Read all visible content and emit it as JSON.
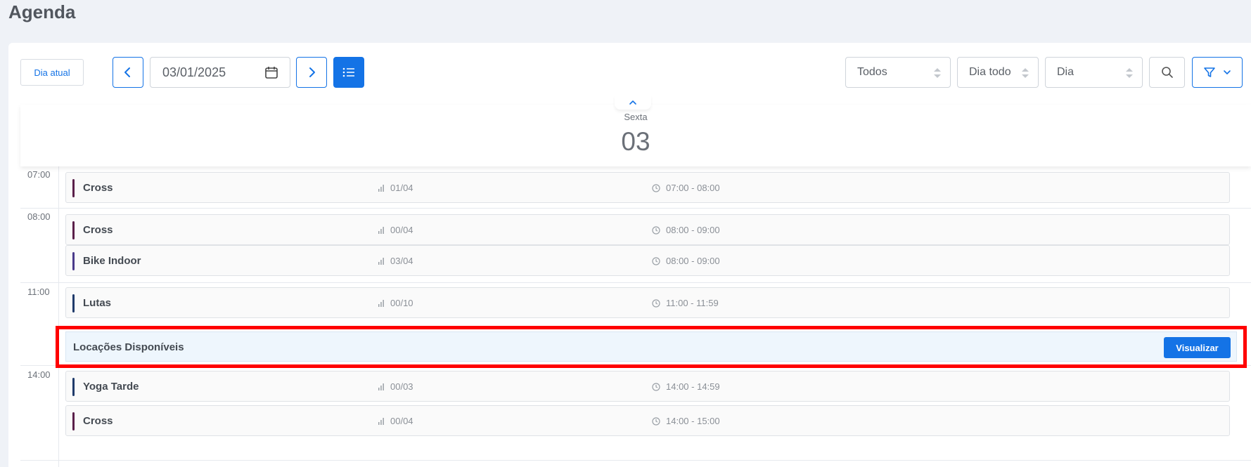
{
  "page": {
    "title": "Agenda"
  },
  "toolbar": {
    "today_label": "Dia atual",
    "date_value": "03/01/2025",
    "select_status": "Todos",
    "select_period": "Dia todo",
    "select_view": "Dia"
  },
  "day": {
    "weekday": "Sexta",
    "number": "03"
  },
  "hours": [
    "07:00",
    "08:00",
    "11:00",
    "14:00"
  ],
  "events": [
    {
      "name": "Cross",
      "occupancy": "01/04",
      "time": "07:00 - 08:00",
      "color": "#5a1f4a"
    },
    {
      "name": "Cross",
      "occupancy": "00/04",
      "time": "08:00 - 09:00",
      "color": "#5a1f4a"
    },
    {
      "name": "Bike Indoor",
      "occupancy": "03/04",
      "time": "08:00 - 09:00",
      "color": "#4a3a8a"
    },
    {
      "name": "Lutas",
      "occupancy": "00/10",
      "time": "11:00 - 11:59",
      "color": "#1f3a6a"
    },
    {
      "name": "Yoga Tarde",
      "occupancy": "00/03",
      "time": "14:00 - 14:59",
      "color": "#1f3a6a"
    },
    {
      "name": "Cross",
      "occupancy": "00/04",
      "time": "14:00 - 15:00",
      "color": "#5a1f4a"
    }
  ],
  "locacoes": {
    "title": "Locações Disponíveis",
    "button_label": "Visualizar"
  },
  "colors": {
    "accent": "#1473e6",
    "highlight": "#ff0000"
  }
}
